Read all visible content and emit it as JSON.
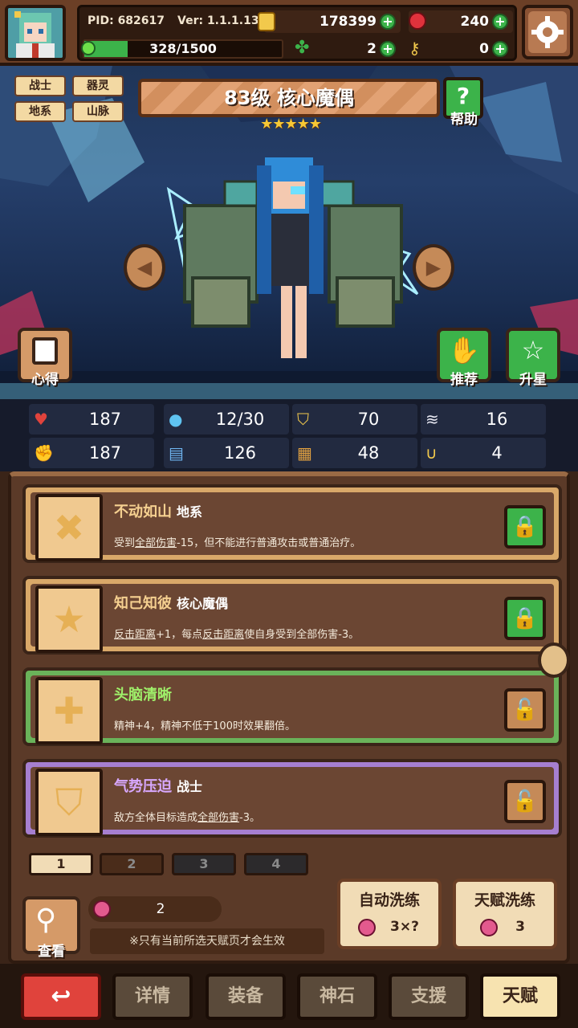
{
  "header": {
    "pid": "PID: 682617",
    "version": "Ver: 1.1.1.13",
    "exp": "328/1500",
    "gold": "178399",
    "gems": "240",
    "clover": "2",
    "keys": "0",
    "exp_progress": 0.2187
  },
  "hero": {
    "tags": [
      "战士",
      "器灵",
      "地系",
      "山脉"
    ],
    "title": "83级  核心魔偶",
    "stars": 5,
    "help_label": "帮助",
    "notes_label": "心得",
    "recommend_label": "推荐",
    "upstar_label": "升星"
  },
  "stats": [
    {
      "icon": "heart-icon",
      "value": "187"
    },
    {
      "icon": "water-drop-icon",
      "value": "12/30"
    },
    {
      "icon": "shield-icon",
      "value": "70"
    },
    {
      "icon": "wing-icon",
      "value": "16"
    },
    {
      "icon": "fist-icon",
      "value": "187"
    },
    {
      "icon": "book-icon",
      "value": "126"
    },
    {
      "icon": "scroll-icon",
      "value": "48"
    },
    {
      "icon": "horseshoe-icon",
      "value": "4"
    }
  ],
  "talents": [
    {
      "name": "不动如山",
      "type": "地系",
      "desc_pre": "受到",
      "desc_u1": "全部伤害",
      "desc_mid": "-15，但不能进行普通攻击或普通治疗。",
      "desc_u2": "",
      "desc_post": "",
      "name_color": "#f5d090",
      "locked": true,
      "border": "#d9a869"
    },
    {
      "name": "知己知彼",
      "type": "核心魔偶",
      "desc_pre": "",
      "desc_u1": "反击距离",
      "desc_mid": "+1，每点",
      "desc_u2": "反击距离",
      "desc_post": "使自身受到全部伤害-3。",
      "name_color": "#f5d090",
      "locked": true,
      "border": "#d9a869"
    },
    {
      "name": "头脑清晰",
      "type": "",
      "desc_pre": "精神+4，精神不低于100时效果翻倍。",
      "desc_u1": "",
      "desc_mid": "",
      "desc_u2": "",
      "desc_post": "",
      "name_color": "#9ff06a",
      "locked": false,
      "border": "#6ab35a"
    },
    {
      "name": "气势压迫",
      "type": "战士",
      "desc_pre": "敌方全体目标造成",
      "desc_u1": "全部伤害",
      "desc_mid": "-3。",
      "desc_u2": "",
      "desc_post": "",
      "name_color": "#d8a8ff",
      "locked": false,
      "border": "#a67fd0"
    }
  ],
  "pages": [
    "1",
    "2",
    "3",
    "4"
  ],
  "bottom": {
    "view_label": "查看",
    "potion_count": "2",
    "note": "※只有当前所选天赋页才会生效",
    "auto_refine_label": "自动洗练",
    "auto_refine_cost": "3×?",
    "talent_refine_label": "天赋洗练",
    "talent_refine_cost": "3"
  },
  "nav": [
    "详情",
    "装备",
    "神石",
    "支援",
    "天赋"
  ],
  "colors": {
    "green": "#3cb34a",
    "accent": "#f7e3b0",
    "panel": "#5b3a28"
  }
}
